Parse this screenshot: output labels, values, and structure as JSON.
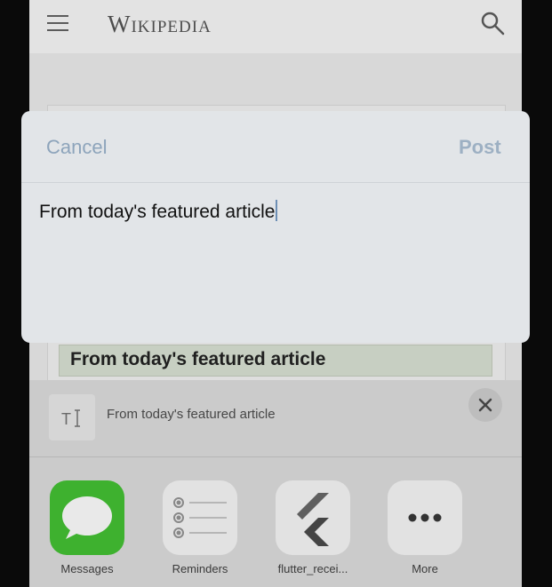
{
  "header": {
    "logo_text": "Wikipedia"
  },
  "page": {
    "featured_heading": "From today's featured article"
  },
  "compose": {
    "cancel_label": "Cancel",
    "post_label": "Post",
    "text": "From today's featured article"
  },
  "share_sheet": {
    "attachment_title": "From today's featured article",
    "attachment_icon": "text-document-icon",
    "apps": [
      {
        "label": "Messages",
        "icon": "messages-icon",
        "color": "#3eb12f"
      },
      {
        "label": "Reminders",
        "icon": "reminders-icon"
      },
      {
        "label": "flutter_recei...",
        "icon": "flutter-icon"
      },
      {
        "label": "More",
        "icon": "more-icon"
      }
    ]
  }
}
